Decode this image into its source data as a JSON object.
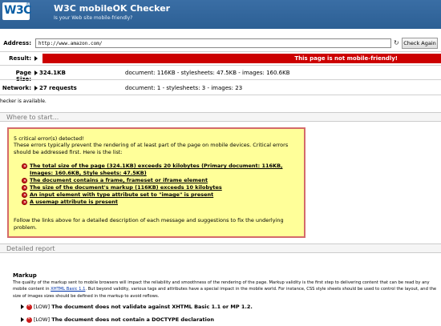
{
  "header": {
    "logo_text": "W3C",
    "logo_mark": "®",
    "title": "W3C mobileOK Checker",
    "subtitle": "Is your Web site mobile-friendly?"
  },
  "address": {
    "label": "Address:",
    "value": "http://www.amazon.com/",
    "go_icon": "↻",
    "check_label": "Check Again"
  },
  "result": {
    "label": "Result:",
    "text": "This page is not mobile-friendly!",
    "color": "#cc0000"
  },
  "page_size": {
    "label": "Page Size:",
    "value": "324.1KB",
    "detail": "document: 116KB - stylesheets: 47.5KB - images: 160.6KB"
  },
  "network": {
    "label": "Network:",
    "value": "27 requests",
    "detail": "document: 1 - stylesheets: 3 - images: 23"
  },
  "checker_note": "hecker is available.",
  "where_to_start": "Where to start...",
  "critical": {
    "title": "5 critical error(s) detected!",
    "description": "These errors typically prevent the rendering of at least part of the page on mobile devices. Critical errors should be addressed first. Here is the list:",
    "items": [
      "The total size of the page (324.1KB) exceeds 20 kilobytes (Primary document: 116KB, Images: 160.6KB, Style sheets: 47.5KB)",
      "The document contains a frame, frameset or iframe element",
      "The size of the document's markup (116KB) exceeds 10 kilobytes",
      "An input element with type attribute set to \"image\" is present",
      "A usemap attribute is present"
    ],
    "follow": "Follow the links above for a detailed description of each message and suggestions to fix the underlying problem."
  },
  "detailed_report": "Detailed report",
  "markup": {
    "title": "Markup",
    "desc_before": "The quality of the markup sent to mobile browsers will impact the reliability and smoothness of the rendering of the page. Markup validity is the first step to delivering content that can be read by any mobile content in ",
    "desc_link": "XHTML Basic 1.1",
    "desc_after": ". But beyond validity, various tags and attributes have a special impact in the mobile world. For instance, CSS style sheets should be used to control the layout, and the size of images sizes should be defined in the markup to avoid reflows.",
    "issues": [
      {
        "level": "[LOW]",
        "text": "The document does not validate against XHTML Basic 1.1 or MP 1.2."
      },
      {
        "level": "[LOW]",
        "text": "The document does not contain a DOCTYPE declaration"
      }
    ]
  }
}
